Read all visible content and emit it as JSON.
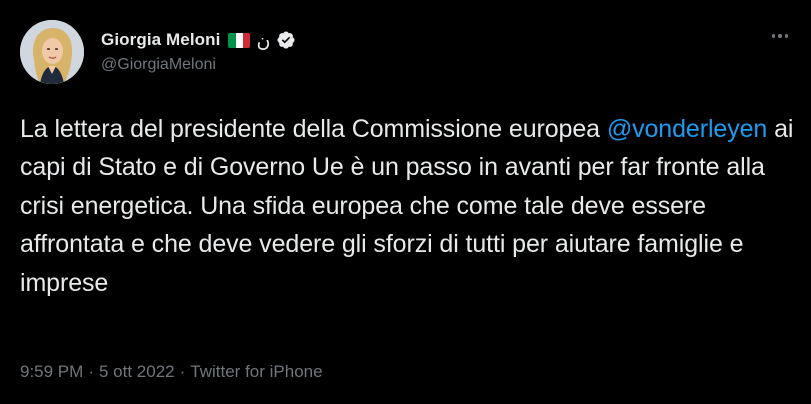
{
  "author": {
    "display_name": "Giorgia Meloni",
    "name_emoji_glyph": "ن",
    "handle": "@GiorgiaMeloni",
    "flag_colors": [
      "#009246",
      "#ffffff",
      "#ce2b37"
    ],
    "verified_icon": "verified-badge-icon"
  },
  "tweet": {
    "text_before_mention": "La lettera del presidente della Commissione europea ",
    "mention": "@vonderleyen",
    "text_after_mention": " ai capi di Stato e di Governo Ue è un passo in avanti per far fronte alla crisi energetica. Una sfida europea che come tale deve essere affrontata e che deve vedere gli sforzi di tutti per aiutare famiglie e imprese"
  },
  "meta": {
    "time": "9:59 PM",
    "separator": "·",
    "date": "5 ott 2022",
    "source": "Twitter for iPhone"
  },
  "colors": {
    "background": "#000000",
    "text": "#e7e9ea",
    "secondary": "#71767b",
    "accent": "#1d9bf0"
  }
}
